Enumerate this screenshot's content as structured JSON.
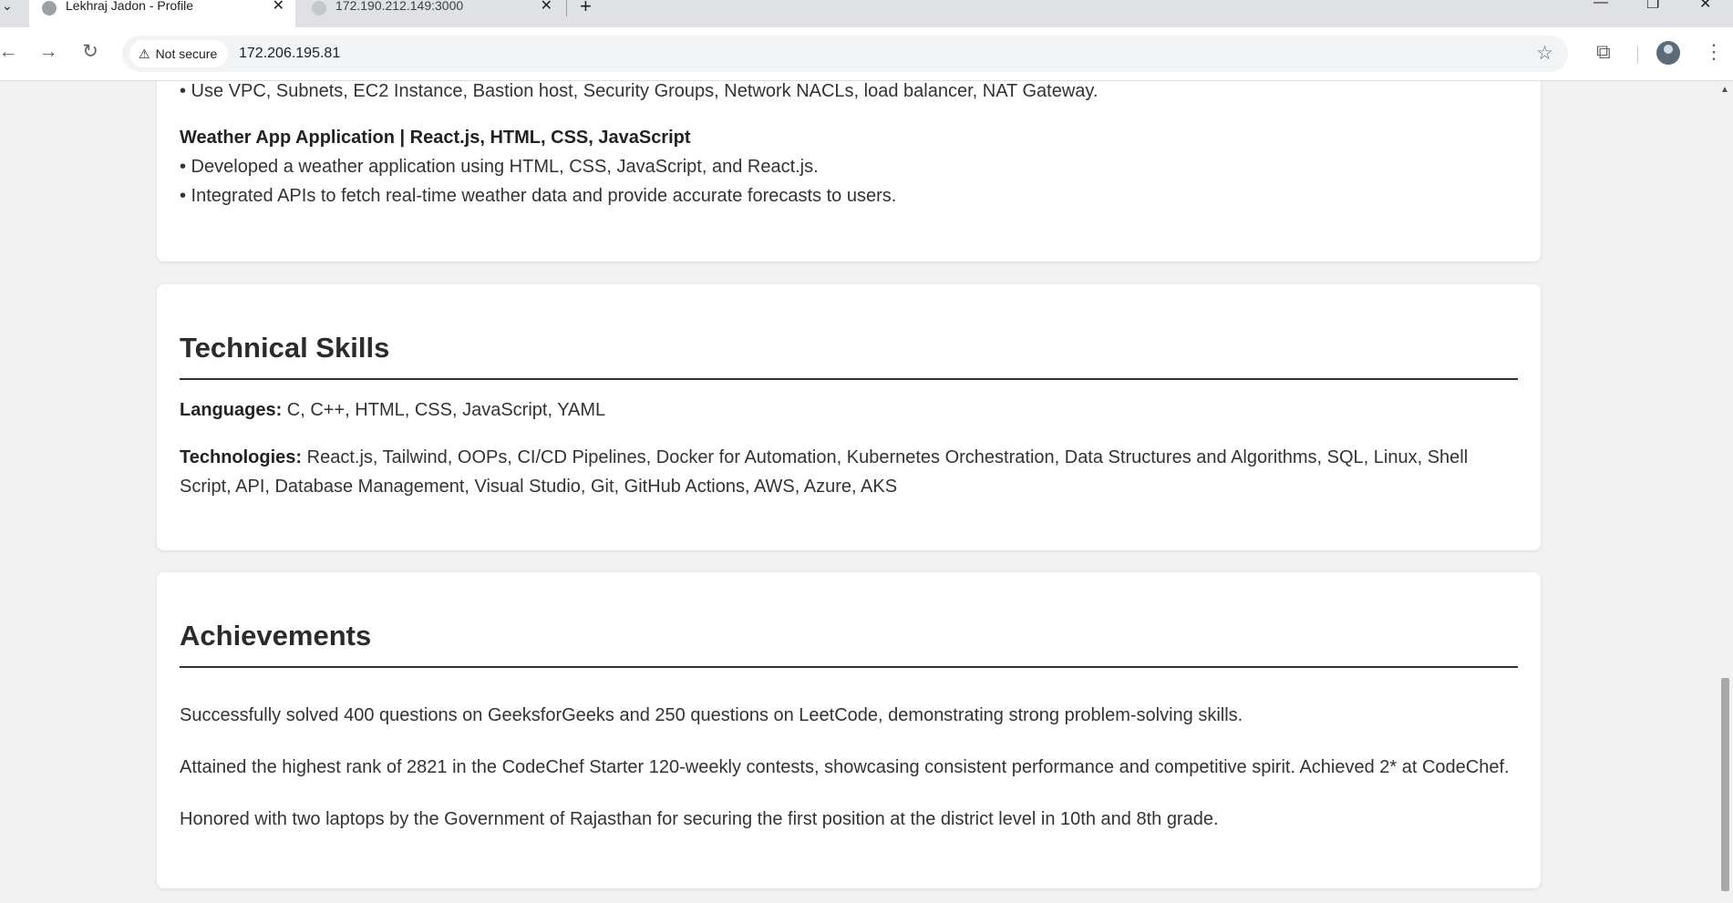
{
  "browser": {
    "tabs": [
      {
        "title": "Lekhraj Jadon - Profile",
        "active": true
      },
      {
        "title": "172.190.212.149:3000",
        "active": false
      }
    ],
    "new_tab_icon": "+",
    "close_icon": "✕",
    "security_label": "Not secure",
    "url": "172.206.195.81"
  },
  "projects_card": {
    "vpc_bullet": "• Use VPC, Subnets, EC2 Instance, Bastion host, Security Groups, Network NACLs, load balancer, NAT Gateway.",
    "weather_title": "Weather App Application | React.js, HTML, CSS, JavaScript",
    "weather_bullets": [
      "• Developed a weather application using HTML, CSS, JavaScript, and React.js.",
      "• Integrated APIs to fetch real-time weather data and provide accurate forecasts to users."
    ]
  },
  "skills_card": {
    "title": "Technical Skills",
    "languages_label": "Languages:",
    "languages_value": " C, C++, HTML, CSS, JavaScript, YAML",
    "technologies_label": "Technologies:",
    "technologies_value": " React.js, Tailwind, OOPs, CI/CD Pipelines, Docker for Automation, Kubernetes Orchestration, Data Structures and Algorithms, SQL, Linux, Shell Script, API, Database Management, Visual Studio, Git, GitHub Actions, AWS, Azure, AKS"
  },
  "achievements_card": {
    "title": "Achievements",
    "items": [
      "Successfully solved 400 questions on GeeksforGeeks and 250 questions on LeetCode, demonstrating strong problem-solving skills.",
      "Attained the highest rank of 2821 in the CodeChef Starter 120-weekly contests, showcasing consistent performance and competitive spirit. Achieved 2* at CodeChef.",
      "Honored with two laptops by the Government of Rajasthan for securing the first position at the district level in 10th and 8th grade."
    ]
  }
}
